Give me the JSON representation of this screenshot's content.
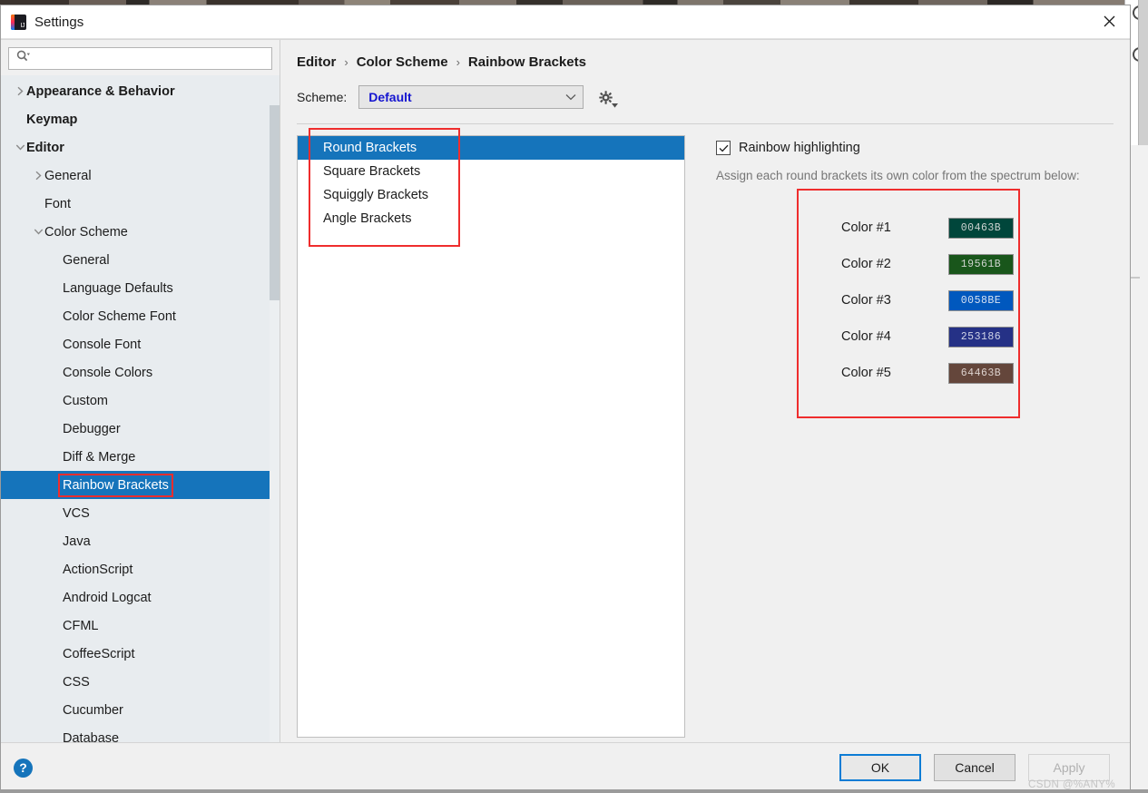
{
  "window": {
    "title": "Settings",
    "logo_text": "IJ",
    "close_icon": "close-icon"
  },
  "search": {
    "value": "",
    "placeholder": ""
  },
  "sidebar": {
    "items": [
      {
        "label": "Appearance & Behavior",
        "indent": 0,
        "arrow": "collapsed",
        "bold": true,
        "selected": false,
        "highlight": false
      },
      {
        "label": "Keymap",
        "indent": 0,
        "arrow": "none",
        "bold": true,
        "selected": false,
        "highlight": false
      },
      {
        "label": "Editor",
        "indent": 0,
        "arrow": "expanded",
        "bold": true,
        "selected": false,
        "highlight": false
      },
      {
        "label": "General",
        "indent": 1,
        "arrow": "collapsed",
        "bold": false,
        "selected": false,
        "highlight": false
      },
      {
        "label": "Font",
        "indent": 1,
        "arrow": "none",
        "bold": false,
        "selected": false,
        "highlight": false
      },
      {
        "label": "Color Scheme",
        "indent": 1,
        "arrow": "expanded",
        "bold": false,
        "selected": false,
        "highlight": false
      },
      {
        "label": "General",
        "indent": 2,
        "arrow": "none",
        "bold": false,
        "selected": false,
        "highlight": false
      },
      {
        "label": "Language Defaults",
        "indent": 2,
        "arrow": "none",
        "bold": false,
        "selected": false,
        "highlight": false
      },
      {
        "label": "Color Scheme Font",
        "indent": 2,
        "arrow": "none",
        "bold": false,
        "selected": false,
        "highlight": false
      },
      {
        "label": "Console Font",
        "indent": 2,
        "arrow": "none",
        "bold": false,
        "selected": false,
        "highlight": false
      },
      {
        "label": "Console Colors",
        "indent": 2,
        "arrow": "none",
        "bold": false,
        "selected": false,
        "highlight": false
      },
      {
        "label": "Custom",
        "indent": 2,
        "arrow": "none",
        "bold": false,
        "selected": false,
        "highlight": false
      },
      {
        "label": "Debugger",
        "indent": 2,
        "arrow": "none",
        "bold": false,
        "selected": false,
        "highlight": false
      },
      {
        "label": "Diff & Merge",
        "indent": 2,
        "arrow": "none",
        "bold": false,
        "selected": false,
        "highlight": false
      },
      {
        "label": "Rainbow Brackets",
        "indent": 2,
        "arrow": "none",
        "bold": false,
        "selected": true,
        "highlight": true
      },
      {
        "label": "VCS",
        "indent": 2,
        "arrow": "none",
        "bold": false,
        "selected": false,
        "highlight": false
      },
      {
        "label": "Java",
        "indent": 2,
        "arrow": "none",
        "bold": false,
        "selected": false,
        "highlight": false
      },
      {
        "label": "ActionScript",
        "indent": 2,
        "arrow": "none",
        "bold": false,
        "selected": false,
        "highlight": false
      },
      {
        "label": "Android Logcat",
        "indent": 2,
        "arrow": "none",
        "bold": false,
        "selected": false,
        "highlight": false
      },
      {
        "label": "CFML",
        "indent": 2,
        "arrow": "none",
        "bold": false,
        "selected": false,
        "highlight": false
      },
      {
        "label": "CoffeeScript",
        "indent": 2,
        "arrow": "none",
        "bold": false,
        "selected": false,
        "highlight": false
      },
      {
        "label": "CSS",
        "indent": 2,
        "arrow": "none",
        "bold": false,
        "selected": false,
        "highlight": false
      },
      {
        "label": "Cucumber",
        "indent": 2,
        "arrow": "none",
        "bold": false,
        "selected": false,
        "highlight": false
      },
      {
        "label": "Database",
        "indent": 2,
        "arrow": "none",
        "bold": false,
        "selected": false,
        "highlight": false
      }
    ]
  },
  "breadcrumb": {
    "parts": [
      "Editor",
      "Color Scheme",
      "Rainbow Brackets"
    ],
    "separator": "›"
  },
  "scheme": {
    "label": "Scheme:",
    "value": "Default",
    "options": [
      "Default"
    ],
    "gear_icon": "gear-icon",
    "caret_icon": "chevron-down-icon"
  },
  "brackets": {
    "items": [
      {
        "label": "Round Brackets",
        "selected": true
      },
      {
        "label": "Square Brackets",
        "selected": false
      },
      {
        "label": "Squiggly Brackets",
        "selected": false
      },
      {
        "label": "Angle Brackets",
        "selected": false
      }
    ]
  },
  "options": {
    "rainbow_checkbox": {
      "label": "Rainbow highlighting",
      "checked": true
    },
    "description": "Assign each round brackets its own color from the spectrum below:",
    "colors": [
      {
        "name": "Color #1",
        "hex": "00463B",
        "bg": "#00463B",
        "fg": "#cfd4d2"
      },
      {
        "name": "Color #2",
        "hex": "19561B",
        "bg": "#19561B",
        "fg": "#cfd4cf"
      },
      {
        "name": "Color #3",
        "hex": "0058BE",
        "bg": "#0058BE",
        "fg": "#d6e2f2"
      },
      {
        "name": "Color #4",
        "hex": "253186",
        "bg": "#253186",
        "fg": "#cfd3e6"
      },
      {
        "name": "Color #5",
        "hex": "64463B",
        "bg": "#64463B",
        "fg": "#ded3cf"
      }
    ]
  },
  "footer": {
    "help_label": "?",
    "ok_label": "OK",
    "cancel_label": "Cancel",
    "apply_label": "Apply",
    "watermark": "CSDN @%ANY%"
  },
  "colors": {
    "selection_blue": "#1574bb",
    "highlight_red": "#ef2d2d",
    "accent_link": "#1414d0"
  }
}
